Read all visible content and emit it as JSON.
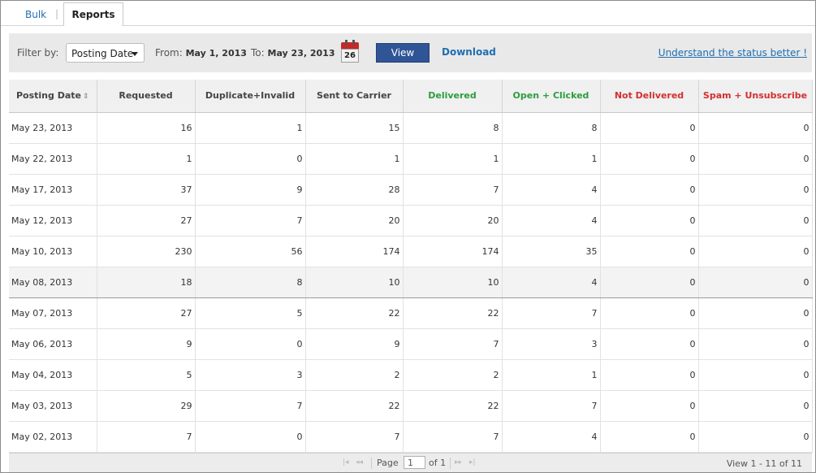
{
  "tabs": {
    "bulk": "Bulk",
    "separator": "|",
    "reports": "Reports"
  },
  "filter": {
    "label": "Filter by:",
    "selected": "Posting Date",
    "from_label": "From:",
    "from_value": "May 1, 2013",
    "to_label": "To:",
    "to_value": "May 23, 2013",
    "calendar_day": "26",
    "view_button": "View",
    "download_link": "Download",
    "help_link": "Understand the status better !"
  },
  "table": {
    "columns": [
      "Posting Date",
      "Requested",
      "Duplicate+Invalid",
      "Sent to Carrier",
      "Delivered",
      "Open + Clicked",
      "Not Delivered",
      "Spam + Unsubscribe"
    ],
    "rows": [
      [
        "May 23, 2013",
        "16",
        "1",
        "15",
        "8",
        "8",
        "0",
        "0"
      ],
      [
        "May 22, 2013",
        "1",
        "0",
        "1",
        "1",
        "1",
        "0",
        "0"
      ],
      [
        "May 17, 2013",
        "37",
        "9",
        "28",
        "7",
        "4",
        "0",
        "0"
      ],
      [
        "May 12, 2013",
        "27",
        "7",
        "20",
        "20",
        "4",
        "0",
        "0"
      ],
      [
        "May 10, 2013",
        "230",
        "56",
        "174",
        "174",
        "35",
        "0",
        "0"
      ],
      [
        "May 08, 2013",
        "18",
        "8",
        "10",
        "10",
        "4",
        "0",
        "0"
      ],
      [
        "May 07, 2013",
        "27",
        "5",
        "22",
        "22",
        "7",
        "0",
        "0"
      ],
      [
        "May 06, 2013",
        "9",
        "0",
        "9",
        "7",
        "3",
        "0",
        "0"
      ],
      [
        "May 04, 2013",
        "5",
        "3",
        "2",
        "2",
        "1",
        "0",
        "0"
      ],
      [
        "May 03, 2013",
        "29",
        "7",
        "22",
        "22",
        "7",
        "0",
        "0"
      ],
      [
        "May 02, 2013",
        "7",
        "0",
        "7",
        "7",
        "4",
        "0",
        "0"
      ]
    ]
  },
  "pager": {
    "page_label": "Page",
    "page_value": "1",
    "of_label": "of 1",
    "view_info": "View 1 - 11 of 11"
  },
  "colors": {
    "accent": "#2f5597",
    "link": "#1f6fb2",
    "green": "#2a9d3e",
    "red": "#d32f2f"
  }
}
